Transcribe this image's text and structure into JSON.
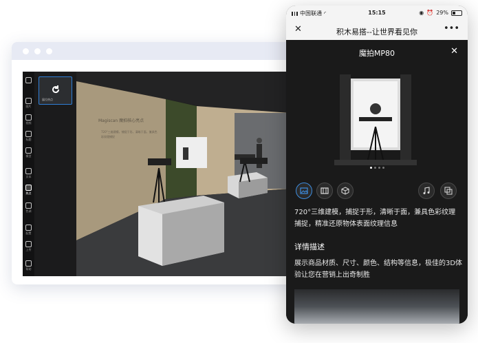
{
  "desktop": {
    "toolbar": [
      {
        "icon": "cube-icon",
        "label": ""
      },
      {
        "icon": "image-icon",
        "label": "图片"
      },
      {
        "icon": "video-icon",
        "label": "视频"
      },
      {
        "icon": "text-icon",
        "label": "标题"
      },
      {
        "icon": "model-icon",
        "label": "模型"
      },
      {
        "icon": "text-icon",
        "label": "文本"
      },
      {
        "icon": "pano-icon",
        "label": "热点"
      },
      {
        "icon": "color-icon",
        "label": "色调"
      },
      {
        "icon": "settings-icon",
        "label": "配置"
      },
      {
        "icon": "upload-icon",
        "label": "上传"
      },
      {
        "icon": "help-icon",
        "label": "帮助"
      }
    ],
    "thumbnail_label": "展位热点",
    "scene_heading": "Magiscan  魔拍核心亮点",
    "scene_subtext": "720°三维建模，捕捉于形，清晰于面，兼具色彩纹理捕捉"
  },
  "phone": {
    "status": {
      "carrier": "中国联通",
      "time": "15:15",
      "battery": "29%"
    },
    "wechat_title": "积木易搭--让世界看见你",
    "product_title": "魔拍MP80",
    "description": "720°三维建模，捕捉于形，清晰于面，兼具色彩纹理捕捉，精准还原物体表面纹理信息",
    "detail_heading": "详情描述",
    "detail_text": "展示商品材质、尺寸、颜色、结构等信息，极佳的3D体验让您在营销上出奇制胜"
  },
  "colors": {
    "accent": "#2f7fd8",
    "window_bar": "#e7eaf4",
    "phone_bg": "#1a1a1a"
  }
}
